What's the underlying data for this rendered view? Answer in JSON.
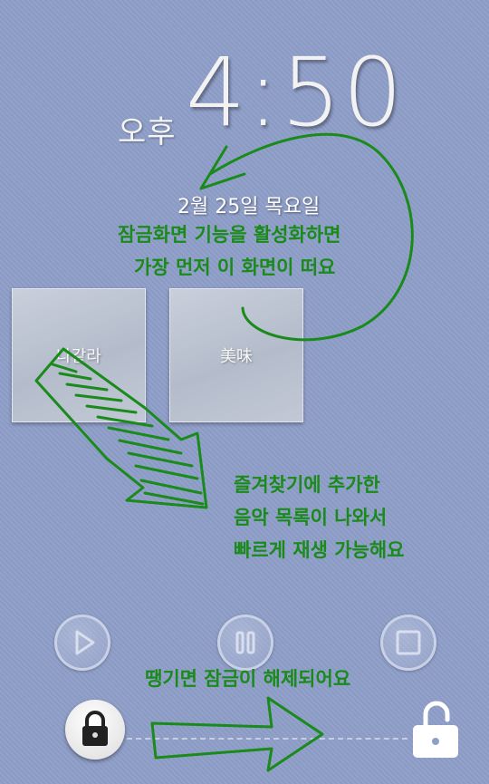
{
  "lockscreen": {
    "ampm": "오후",
    "time": "4:50",
    "date": "2월 25일 목요일"
  },
  "favorites": [
    {
      "label": "나같라"
    },
    {
      "label": "美味"
    }
  ],
  "controls": {
    "play_icon": "play-icon",
    "pause_icon": "pause-icon",
    "stop_icon": "stop-icon"
  },
  "lock": {
    "lock_icon": "lock-icon",
    "unlock_icon": "unlock-icon"
  },
  "annotations": {
    "intro_line1": "잠금화면 기능을 활성화하면",
    "intro_line2": "가장 먼저 이 화면이 떠요",
    "fav_line1": "즐겨찾기에 추가한",
    "fav_line2": "음악 목록이 나와서",
    "fav_line3": "빠르게 재생 가능해요",
    "unlock_hint": "땡기면 잠금이 해제되어요"
  },
  "colors": {
    "background": "#8f9fc9",
    "annotation": "#1a8a1a"
  }
}
